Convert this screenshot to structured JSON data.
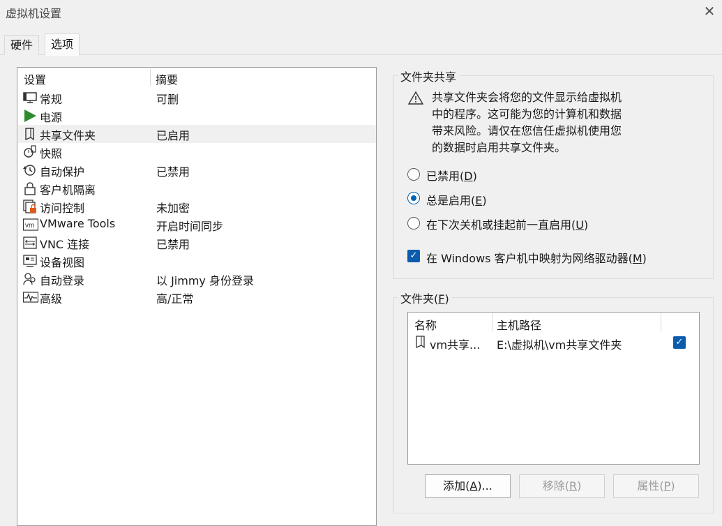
{
  "window": {
    "title": "虚拟机设置"
  },
  "tabs": [
    {
      "label": "硬件"
    },
    {
      "label": "选项"
    }
  ],
  "settings": {
    "header_setting": "设置",
    "header_summary": "摘要",
    "items": [
      {
        "name": "常规",
        "summary": "可删",
        "icon": "monitor-icon"
      },
      {
        "name": "电源",
        "summary": "",
        "icon": "play-icon"
      },
      {
        "name": "共享文件夹",
        "summary": "已启用",
        "icon": "folder-icon"
      },
      {
        "name": "快照",
        "summary": "",
        "icon": "snapshot-icon"
      },
      {
        "name": "自动保护",
        "summary": "已禁用",
        "icon": "history-icon"
      },
      {
        "name": "客户机隔离",
        "summary": "",
        "icon": "lock-icon"
      },
      {
        "name": "访问控制",
        "summary": "未加密",
        "icon": "access-control-icon"
      },
      {
        "name": "VMware Tools",
        "summary": "开启时间同步",
        "icon": "vm-icon"
      },
      {
        "name": "VNC 连接",
        "summary": "已禁用",
        "icon": "vnc-icon"
      },
      {
        "name": "设备视图",
        "summary": "",
        "icon": "device-view-icon"
      },
      {
        "name": "自动登录",
        "summary": "以 Jimmy 身份登录",
        "icon": "users-icon"
      },
      {
        "name": "高级",
        "summary": "高/正常",
        "icon": "pulse-icon"
      }
    ]
  },
  "sharing": {
    "group_title": "文件夹共享",
    "warning": [
      "共享文件夹会将您的文件显示给虚拟机",
      "中的程序。这可能为您的计算机和数据",
      "带来风险。请仅在您信任虚拟机使用您",
      "的数据时启用共享文件夹。"
    ],
    "opt_disabled": "已禁用(",
    "opt_disabled_key": "D",
    "opt_always": "总是启用(",
    "opt_always_key": "E",
    "opt_until": "在下次关机或挂起前一直启用(",
    "opt_until_key": "U",
    "close_paren": ")",
    "map_label": "在 Windows 客户机中映射为网络驱动器(",
    "map_key": "M",
    "map_checked": true,
    "selected_option": "always"
  },
  "folders": {
    "group_title": "文件夹(",
    "group_key": "F",
    "col_name": "名称",
    "col_path": "主机路径",
    "rows": [
      {
        "name": "vm共享...",
        "path": "E:\\虚拟机\\vm共享文件夹",
        "enabled": true
      }
    ],
    "btn_add": "添加(",
    "btn_add_key": "A",
    "btn_add_tail": ")...",
    "btn_remove": "移除(",
    "btn_remove_key": "R",
    "btn_props": "属性(",
    "btn_props_key": "P"
  }
}
